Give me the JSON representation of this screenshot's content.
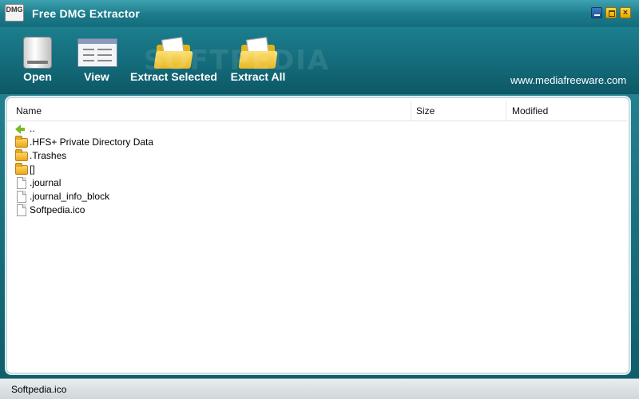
{
  "window": {
    "title": "Free DMG Extractor",
    "app_icon_text": "DMG"
  },
  "toolbar": {
    "open_label": "Open",
    "view_label": "View",
    "extract_selected_label": "Extract Selected",
    "extract_all_label": "Extract All",
    "website": "www.mediafreeware.com"
  },
  "watermark": "SOFTPEDIA",
  "list": {
    "columns": [
      "Name",
      "Size",
      "Modified"
    ],
    "rows": [
      {
        "name": "..",
        "type": "parent",
        "icon": "back-arrow-icon"
      },
      {
        "name": ".HFS+ Private Directory Data",
        "type": "folder",
        "icon": "folder-icon"
      },
      {
        "name": ".Trashes",
        "type": "folder",
        "icon": "folder-icon"
      },
      {
        "name": "[]",
        "type": "folder",
        "icon": "folder-icon"
      },
      {
        "name": ".journal",
        "type": "file",
        "icon": "file-icon"
      },
      {
        "name": ".journal_info_block",
        "type": "file",
        "icon": "file-icon"
      },
      {
        "name": "Softpedia.ico",
        "type": "file",
        "icon": "file-icon"
      }
    ]
  },
  "statusbar": {
    "text": "Softpedia.ico"
  },
  "colors": {
    "titlebar": "#1d7d8d",
    "toolbar": "#136978",
    "folder": "#e8a81a",
    "back_arrow": "#7ab827"
  }
}
